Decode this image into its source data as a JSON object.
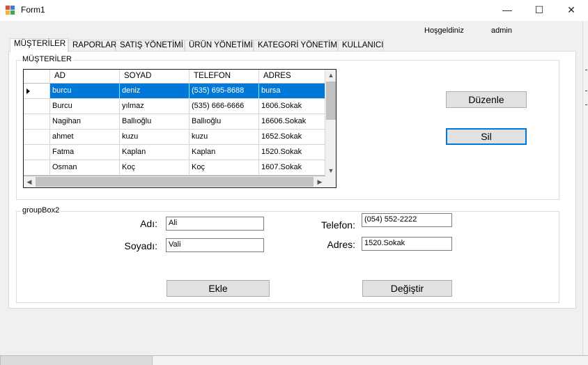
{
  "window": {
    "title": "Form1",
    "minimize": "—",
    "maximize": "☐",
    "close": "✕"
  },
  "header": {
    "welcome": "Hoşgeldiniz",
    "user": "admin"
  },
  "tabs": [
    {
      "label": "MÜŞTERİLER"
    },
    {
      "label": "RAPORLAR"
    },
    {
      "label": "SATIŞ YÖNETİMİ"
    },
    {
      "label": "ÜRÜN YÖNETİMİ"
    },
    {
      "label": "KATEGORİ YÖNETİMİ"
    },
    {
      "label": "KULLANICI"
    }
  ],
  "customers_group": {
    "label": "MÜŞTERİLER",
    "columns": [
      "AD",
      "SOYAD",
      "TELEFON",
      "ADRES"
    ],
    "rows": [
      [
        "burcu",
        "deniz",
        "(535) 695-8688",
        "bursa"
      ],
      [
        "Burcu",
        "yılmaz",
        "(535) 666-6666",
        "1606.Sokak"
      ],
      [
        "Nagihan",
        "Ballıoğlu",
        "Ballıoğlu",
        "16606.Sokak"
      ],
      [
        "ahmet",
        "kuzu",
        "kuzu",
        "1652.Sokak"
      ],
      [
        "Fatma",
        "Kaplan",
        "Kaplan",
        "1520.Sokak"
      ],
      [
        "Osman",
        "Koç",
        "Koç",
        "1607.Sokak"
      ]
    ],
    "selected_row": 0,
    "edit_button": "Düzenle",
    "delete_button": "Sil"
  },
  "form_group": {
    "label": "groupBox2",
    "name_label": "Adı:",
    "name_value": "Ali",
    "surname_label": "Soyadı:",
    "surname_value": "Vali",
    "phone_label": "Telefon:",
    "phone_value": "(054) 552-2222",
    "address_label": "Adres:",
    "address_value": "1520.Sokak",
    "add_button": "Ekle",
    "change_button": "Değiştir"
  },
  "icons": {
    "app": "form-icon",
    "row_selected": "row-pointer-icon",
    "scroll_up": "chevron-up-icon",
    "scroll_down": "chevron-down-icon",
    "scroll_left": "chevron-left-icon",
    "scroll_right": "chevron-right-icon"
  },
  "colors": {
    "selection": "#0078d7",
    "focus_border": "#0078d7"
  }
}
